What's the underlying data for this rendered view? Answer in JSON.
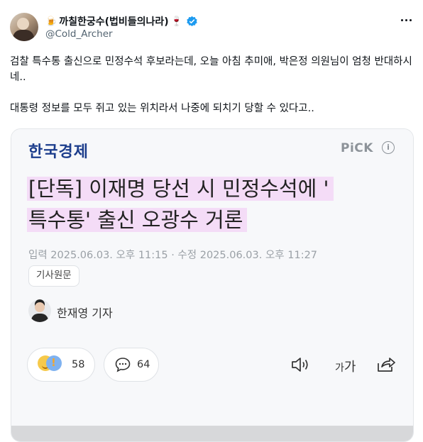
{
  "author": {
    "display_name": "까칠한궁수(법비들의나라)",
    "name_prefix_emoji": "🍺",
    "name_suffix_emoji": "🍷",
    "handle": "@Cold_Archer",
    "verified": true,
    "verified_color": "#1d9bf0"
  },
  "post": {
    "paragraph_1": "검찰 특수통 출신으로 민정수석 후보라는데, 오늘 아침 추미애, 박은정 의원님이 엄청 반대하시네..",
    "paragraph_2": "대통령 정보를 모두 쥐고 있는 위치라서 나중에 되치기 당할 수 있다고.."
  },
  "card": {
    "brand": "한국경제",
    "brand_color": "#1c3d8c",
    "pick_label": "PiCK",
    "info_icon": "i",
    "headline_line_1": "[단독] 이재명 당선 시 민정수석에 '",
    "headline_line_2": "특수통' 출신 오광수 거론",
    "highlight_color": "#f4dcf7",
    "dateline": "입력 2025.06.03. 오후 11:15 · 수정 2025.06.03. 오후 11:27",
    "tag": "기사원문",
    "reporter": "한재영 기자",
    "reactions_count": "58",
    "comments_count": "64",
    "font_size_label_small": "가",
    "font_size_label_large": "가"
  },
  "icons": {
    "more": "more-icon",
    "verified": "verified-badge-icon",
    "speaker": "speaker-icon",
    "share": "share-icon",
    "comment": "comment-icon"
  }
}
